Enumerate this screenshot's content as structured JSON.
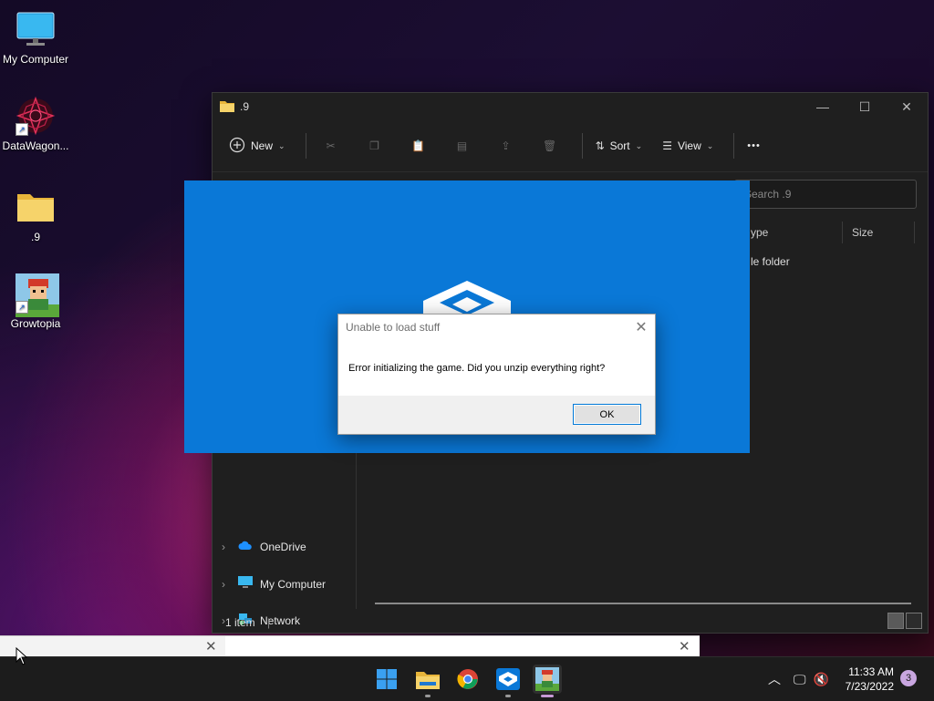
{
  "desktop": {
    "icons": [
      {
        "label": "My Computer"
      },
      {
        "label": "DataWagon..."
      },
      {
        "label": ".9"
      },
      {
        "label": "Growtopia"
      }
    ]
  },
  "explorer": {
    "title": ".9",
    "toolbar": {
      "new_label": "New",
      "sort_label": "Sort",
      "view_label": "View",
      "more_label": "•••"
    },
    "search": {
      "placeholder": "Search .9"
    },
    "columns": [
      "ype",
      "Size"
    ],
    "file_type": "le folder",
    "nav": [
      {
        "label": "OneDrive"
      },
      {
        "label": "My Computer"
      },
      {
        "label": "Network"
      }
    ],
    "status": "1 item"
  },
  "dialog": {
    "title": "Unable to load stuff",
    "message": "Error initializing the game.  Did you unzip everything right?",
    "ok_label": "OK",
    "close_glyph": "✕"
  },
  "taskbar": {
    "time": "11:33 AM",
    "date": "7/23/2022",
    "notification_count": "3"
  },
  "colors": {
    "splash_blue": "#0a78d7",
    "explorer_bg": "#1f1f1f",
    "taskbar_bg": "#1c1c1c",
    "dialog_bg": "#f0f0f0",
    "ok_border": "#0078d7"
  }
}
